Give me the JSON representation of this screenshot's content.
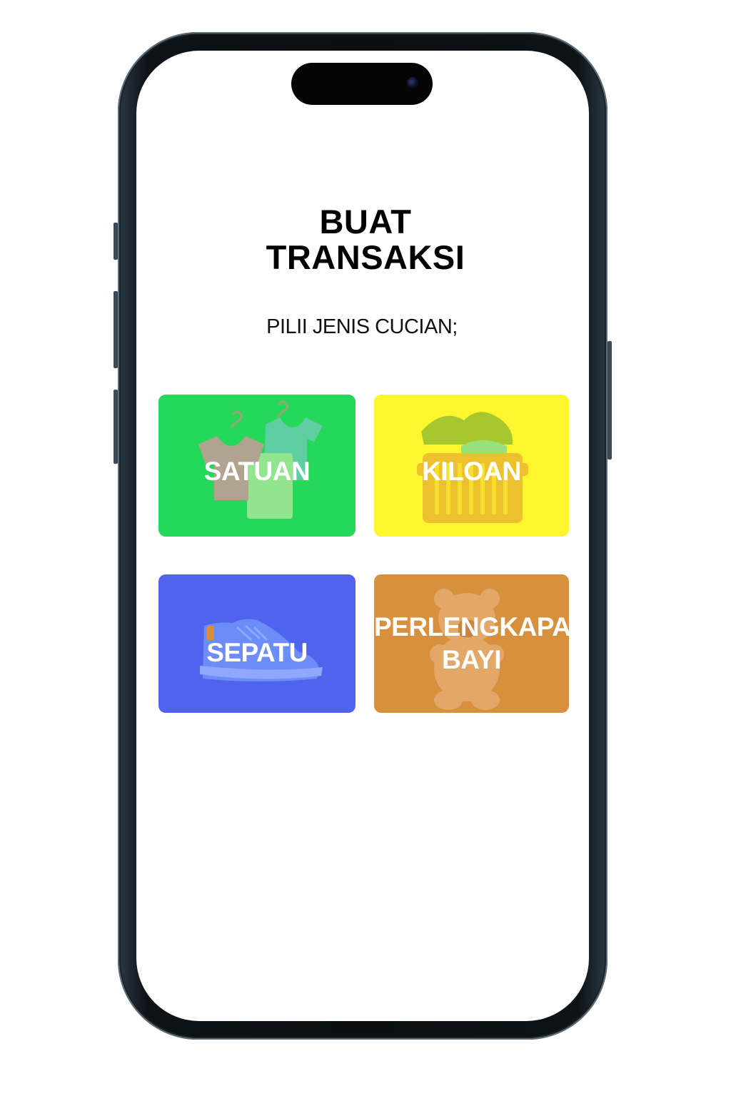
{
  "header": {
    "title_line1": "BUAT",
    "title_line2": "TRANSAKSI",
    "subtitle": "PILII JENIS CUCIAN;"
  },
  "options": [
    {
      "label": "SATUAN",
      "color": "#25d85a",
      "icon": "shirts-icon"
    },
    {
      "label": "KILOAN",
      "color": "#fdf52e",
      "icon": "laundry-basket-icon"
    },
    {
      "label": "SEPATU",
      "color": "#5063ef",
      "icon": "sneaker-icon"
    },
    {
      "label_line1": "PERLENGKAPAN",
      "label_line2": "BAYI",
      "color": "#d8903f",
      "icon": "teddy-bear-icon"
    }
  ]
}
